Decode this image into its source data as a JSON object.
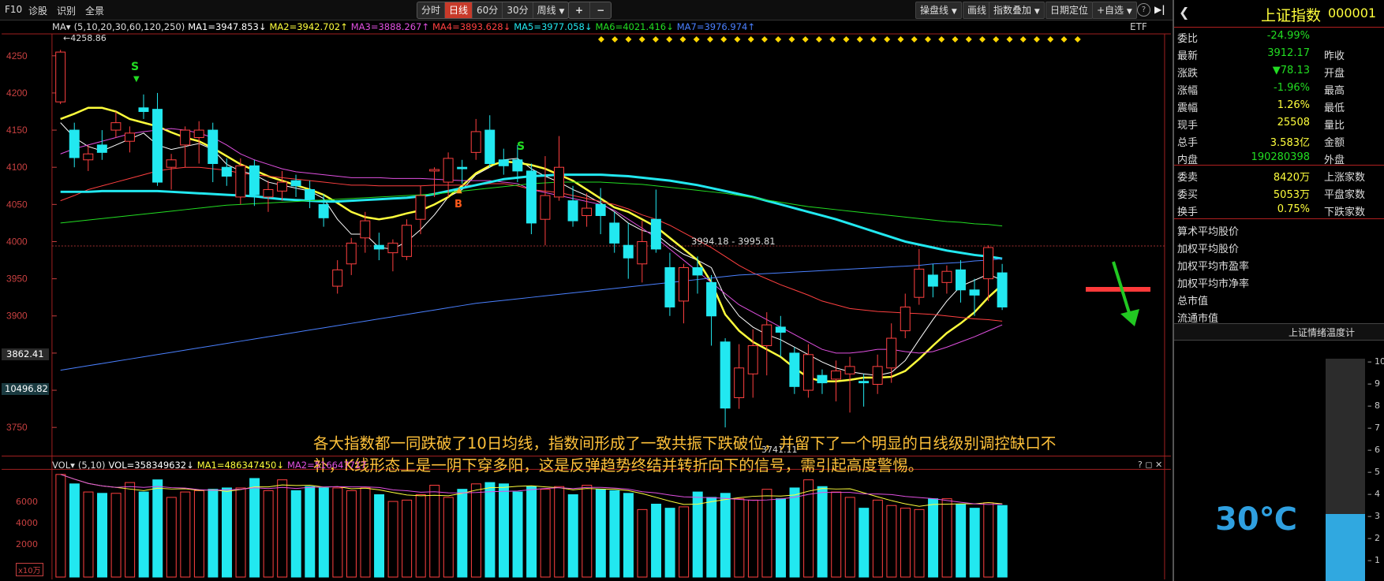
{
  "toolbar": {
    "left": [
      "F10",
      "诊股",
      "识别",
      "全景"
    ],
    "periods": [
      "分时",
      "日线",
      "60分",
      "30分",
      "周线"
    ],
    "active_period": "日线",
    "period_dropdown_icon": "chevron-down-icon",
    "zoom_plus": "+",
    "zoom_minus": "−",
    "right": [
      "操盘线",
      "画线",
      "指数叠加",
      "日期定位",
      "+自选"
    ],
    "help": "?",
    "collapse": "▶|"
  },
  "ma_legend": {
    "label": "MA▾",
    "params": "(5,10,20,30,60,120,250)",
    "items": [
      {
        "text": "MA1=3947.853↓",
        "color": "#ffffff"
      },
      {
        "text": "MA2=3942.702↑",
        "color": "#ffff3c"
      },
      {
        "text": "MA3=3888.267↑",
        "color": "#e050e0"
      },
      {
        "text": "MA4=3893.628↓",
        "color": "#ff4040"
      },
      {
        "text": "MA5=3977.058↓",
        "color": "#22e8f0"
      },
      {
        "text": "MA6=4021.416↓",
        "color": "#22dd22"
      },
      {
        "text": "MA7=3976.974↑",
        "color": "#4a80ff"
      }
    ],
    "etf": "ETF"
  },
  "price_axis": {
    "ticks": [
      "4250",
      "4200",
      "4150",
      "4100",
      "4050",
      "4000",
      "3950",
      "3900",
      "3850",
      "3800",
      "3750"
    ],
    "highlight_price": "3862.41",
    "highlight_vol": "10496.82"
  },
  "annotations": {
    "high_label": "4258.86",
    "low_label": "3741.11",
    "gap_label": "3994.18 - 3995.81",
    "sell_marks": [
      "S",
      "S"
    ],
    "buy_mark": "B"
  },
  "caption": {
    "line1": "各大指数都一同跌破了10日均线，指数间形成了一致共振下跌破位，并留下了一个明显的日线级别调控缺口不",
    "line2": "补，K线形态上是一阴下穿多阳，这是反弹趋势终结并转折向下的信号，需引起高度警惕。"
  },
  "vol_legend": {
    "label": "VOL▾",
    "params": "(5,10)",
    "items": [
      {
        "text": "VOL=358349632↓",
        "color": "#ffffff"
      },
      {
        "text": "MA1=486347450↓",
        "color": "#ffff3c"
      },
      {
        "text": "MA2=516647717",
        "color": "#e050e0"
      }
    ],
    "ticks": [
      "6000",
      "4000",
      "2000"
    ],
    "unit": "x10万",
    "close_icons": "? ◻ ✕"
  },
  "right_panel": {
    "back_icon": "chevron-left-icon",
    "title": "上证指数",
    "code": "000001",
    "rows": [
      {
        "k": "委比",
        "v": "-24.99%",
        "c": "grn",
        "k2": ""
      },
      {
        "k": "最新",
        "v": "3912.17",
        "c": "grn",
        "k2": "昨收"
      },
      {
        "k": "涨跌",
        "v": "▼78.13",
        "c": "grn",
        "k2": "开盘"
      },
      {
        "k": "涨幅",
        "v": "-1.96%",
        "c": "grn",
        "k2": "最高"
      },
      {
        "k": "震幅",
        "v": "1.26%",
        "c": "yel",
        "k2": "最低"
      },
      {
        "k": "现手",
        "v": "25508",
        "c": "yel",
        "k2": "量比"
      },
      {
        "k": "总手",
        "v": "3.583亿",
        "c": "yel",
        "k2": "金额"
      },
      {
        "k": "内盘",
        "v": "190280398",
        "c": "grn",
        "k2": "外盘"
      }
    ],
    "rows2": [
      {
        "k": "委卖",
        "v": "8420万",
        "c": "yel",
        "k2": "上涨家数"
      },
      {
        "k": "委买",
        "v": "5053万",
        "c": "yel",
        "k2": "平盘家数"
      },
      {
        "k": "换手",
        "v": "0.75%",
        "c": "yel",
        "k2": "下跌家数"
      }
    ],
    "list": [
      "算术平均股价",
      "加权平均股价",
      "加权平均市盈率",
      "加权平均市净率",
      "总市值",
      "流通市值"
    ],
    "thermo_title": "上证情绪温度计",
    "thermo_value": "30℃",
    "thermo_level": 0.3,
    "thermo_ticks": [
      "10",
      "9",
      "8",
      "7",
      "6",
      "5",
      "4",
      "3",
      "2",
      "1"
    ]
  },
  "chart_data": {
    "type": "candlestick",
    "ylim": [
      3720,
      4270
    ],
    "candles": [
      [
        4188,
        4255,
        4258,
        4185
      ],
      [
        4150,
        4113,
        4160,
        4100
      ],
      [
        4110,
        4118,
        4130,
        4095
      ],
      [
        4130,
        4120,
        4150,
        4110
      ],
      [
        4150,
        4160,
        4175,
        4140
      ],
      [
        4135,
        4146,
        4155,
        4120
      ],
      [
        4180,
        4175,
        4198,
        4165
      ],
      [
        4178,
        4080,
        4200,
        4075
      ],
      [
        4100,
        4110,
        4118,
        4070
      ],
      [
        4130,
        4150,
        4155,
        4100
      ],
      [
        4140,
        4150,
        4162,
        4105
      ],
      [
        4150,
        4105,
        4160,
        4080
      ],
      [
        4100,
        4088,
        4112,
        4075
      ],
      [
        4060,
        4102,
        4112,
        4050
      ],
      [
        4102,
        4063,
        4110,
        4048
      ],
      [
        4060,
        4070,
        4082,
        4040
      ],
      [
        4068,
        4080,
        4095,
        4055
      ],
      [
        4082,
        4075,
        4090,
        4060
      ],
      [
        4070,
        4057,
        4082,
        4045
      ],
      [
        4050,
        4032,
        4064,
        4020
      ],
      [
        3940,
        3962,
        3975,
        3930
      ],
      [
        3970,
        3998,
        4005,
        3955
      ],
      [
        4005,
        4028,
        4040,
        3985
      ],
      [
        3995,
        3990,
        4012,
        3975
      ],
      [
        3985,
        3998,
        4003,
        3960
      ],
      [
        3980,
        4022,
        4030,
        3975
      ],
      [
        4030,
        4062,
        4075,
        4010
      ],
      [
        4095,
        4097,
        4100,
        4060
      ],
      [
        4080,
        4112,
        4120,
        4060
      ],
      [
        4100,
        4098,
        4110,
        4078
      ],
      [
        4120,
        4148,
        4165,
        4110
      ],
      [
        4150,
        4105,
        4170,
        4100
      ],
      [
        4110,
        4102,
        4125,
        4090
      ],
      [
        4110,
        4095,
        4130,
        4080
      ],
      [
        4095,
        4025,
        4105,
        4010
      ],
      [
        4030,
        4062,
        4115,
        3995
      ],
      [
        4060,
        4100,
        4142,
        4055
      ],
      [
        4055,
        4028,
        4075,
        4020
      ],
      [
        4035,
        4045,
        4065,
        4020
      ],
      [
        4050,
        4035,
        4072,
        4010
      ],
      [
        4025,
        3998,
        4040,
        3985
      ],
      [
        3995,
        3978,
        4025,
        3950
      ],
      [
        3970,
        4000,
        4028,
        3945
      ],
      [
        4030,
        3990,
        4070,
        3985
      ],
      [
        3965,
        3912,
        3985,
        3900
      ],
      [
        3920,
        3965,
        3970,
        3890
      ],
      [
        3965,
        3955,
        3980,
        3930
      ],
      [
        3945,
        3900,
        3955,
        3860
      ],
      [
        3865,
        3776,
        3870,
        3750
      ],
      [
        3790,
        3830,
        3862,
        3775
      ],
      [
        3822,
        3860,
        3882,
        3790
      ],
      [
        3860,
        3888,
        3905,
        3820
      ],
      [
        3885,
        3878,
        3900,
        3845
      ],
      [
        3850,
        3805,
        3858,
        3795
      ],
      [
        3800,
        3848,
        3862,
        3790
      ],
      [
        3820,
        3810,
        3828,
        3795
      ],
      [
        3815,
        3826,
        3840,
        3785
      ],
      [
        3822,
        3832,
        3845,
        3770
      ],
      [
        3812,
        3810,
        3822,
        3778
      ],
      [
        3808,
        3832,
        3848,
        3795
      ],
      [
        3830,
        3870,
        3890,
        3810
      ],
      [
        3880,
        3912,
        3930,
        3870
      ],
      [
        3925,
        3963,
        3990,
        3915
      ],
      [
        3955,
        3940,
        3970,
        3925
      ],
      [
        3945,
        3960,
        3968,
        3930
      ],
      [
        3962,
        3935,
        3975,
        3918
      ],
      [
        3935,
        3928,
        3950,
        3900
      ],
      [
        3950,
        3992,
        3995,
        3920
      ],
      [
        3958,
        3912,
        3970,
        3908
      ]
    ],
    "ma": {
      "MA1": [
        4160,
        4140,
        4128,
        4122,
        4130,
        4138,
        4146,
        4130,
        4124,
        4128,
        4132,
        4124,
        4104,
        4095,
        4090,
        4080,
        4076,
        4072,
        4068,
        4058,
        4030,
        4010,
        4010,
        3992,
        3990,
        4000,
        4016,
        4036,
        4060,
        4070,
        4090,
        4100,
        4110,
        4112,
        4098,
        4088,
        4080,
        4070,
        4062,
        4052,
        4040,
        4025,
        4015,
        4010,
        3995,
        3983,
        3975,
        3965,
        3925,
        3900,
        3885,
        3875,
        3868,
        3858,
        3848,
        3838,
        3830,
        3825,
        3822,
        3820,
        3824,
        3840,
        3868,
        3895,
        3920,
        3940,
        3948,
        3956,
        3948
      ],
      "MA2": [
        4165,
        4172,
        4180,
        4180,
        4175,
        4165,
        4160,
        4155,
        4147,
        4140,
        4135,
        4126,
        4115,
        4104,
        4096,
        4088,
        4082,
        4076,
        4070,
        4063,
        4052,
        4040,
        4033,
        4030,
        4033,
        4038,
        4042,
        4050,
        4060,
        4075,
        4092,
        4102,
        4108,
        4106,
        4103,
        4098,
        4090,
        4082,
        4070,
        4058,
        4046,
        4040,
        4030,
        4020,
        4005,
        3990,
        3975,
        3945,
        3902,
        3880,
        3865,
        3855,
        3845,
        3830,
        3817,
        3812,
        3812,
        3814,
        3817,
        3817,
        3818,
        3826,
        3842,
        3860,
        3877,
        3890,
        3905,
        3925,
        3942
      ],
      "MA3": [
        4118,
        4125,
        4130,
        4135,
        4140,
        4145,
        4148,
        4150,
        4152,
        4150,
        4146,
        4140,
        4130,
        4118,
        4110,
        4104,
        4098,
        4094,
        4092,
        4090,
        4088,
        4086,
        4086,
        4086,
        4085,
        4085,
        4085,
        4084,
        4083,
        4082,
        4082,
        4082,
        4080,
        4078,
        4070,
        4066,
        4062,
        4058,
        4054,
        4050,
        4042,
        4030,
        4018,
        4005,
        3990,
        3975,
        3960,
        3945,
        3930,
        3915,
        3905,
        3895,
        3885,
        3875,
        3865,
        3855,
        3850,
        3850,
        3852,
        3855,
        3855,
        3852,
        3850,
        3852,
        3858,
        3865,
        3872,
        3880,
        3888
      ],
      "MA4": [
        4055,
        4062,
        4070,
        4075,
        4080,
        4085,
        4090,
        4095,
        4098,
        4100,
        4100,
        4098,
        4096,
        4092,
        4090,
        4088,
        4086,
        4084,
        4082,
        4080,
        4078,
        4076,
        4076,
        4075,
        4075,
        4075,
        4075,
        4076,
        4076,
        4076,
        4076,
        4078,
        4078,
        4075,
        4070,
        4068,
        4066,
        4062,
        4058,
        4054,
        4050,
        4044,
        4036,
        4030,
        4022,
        4012,
        4002,
        3992,
        3980,
        3968,
        3958,
        3950,
        3942,
        3935,
        3928,
        3920,
        3915,
        3910,
        3908,
        3906,
        3905,
        3904,
        3903,
        3902,
        3900,
        3898,
        3896,
        3895,
        3893
      ],
      "MA5": [
        4067,
        4067,
        4067,
        4068,
        4068,
        4068,
        4068,
        4068,
        4067,
        4066,
        4065,
        4064,
        4063,
        4062,
        4061,
        4059,
        4057,
        4056,
        4055,
        4054,
        4054,
        4055,
        4056,
        4057,
        4058,
        4059,
        4061,
        4064,
        4068,
        4072,
        4076,
        4080,
        4084,
        4086,
        4088,
        4089,
        4090,
        4090,
        4090,
        4090,
        4089,
        4088,
        4086,
        4084,
        4082,
        4079,
        4076,
        4072,
        4068,
        4064,
        4060,
        4055,
        4050,
        4045,
        4040,
        4035,
        4030,
        4024,
        4018,
        4012,
        4006,
        4000,
        3996,
        3992,
        3988,
        3985,
        3982,
        3980,
        3977
      ],
      "MA6": [
        4025,
        4027,
        4029,
        4031,
        4033,
        4035,
        4037,
        4039,
        4041,
        4043,
        4045,
        4047,
        4049,
        4050,
        4051,
        4052,
        4053,
        4054,
        4055,
        4056,
        4057,
        4058,
        4059,
        4060,
        4061,
        4062,
        4063,
        4064,
        4066,
        4068,
        4070,
        4072,
        4074,
        4076,
        4078,
        4079,
        4080,
        4080,
        4080,
        4080,
        4079,
        4078,
        4077,
        4075,
        4073,
        4071,
        4069,
        4067,
        4065,
        4062,
        4059,
        4056,
        4053,
        4050,
        4047,
        4045,
        4043,
        4041,
        4039,
        4037,
        4035,
        4033,
        4031,
        4029,
        4027,
        4026,
        4024,
        4023,
        4021
      ],
      "MA7": [
        3827,
        3830,
        3833,
        3836,
        3839,
        3842,
        3845,
        3848,
        3851,
        3854,
        3857,
        3860,
        3863,
        3866,
        3869,
        3872,
        3875,
        3878,
        3881,
        3884,
        3887,
        3890,
        3893,
        3896,
        3899,
        3902,
        3905,
        3908,
        3911,
        3914,
        3917,
        3919,
        3921,
        3923,
        3925,
        3927,
        3929,
        3931,
        3933,
        3935,
        3937,
        3939,
        3941,
        3943,
        3945,
        3947,
        3949,
        3951,
        3953,
        3955,
        3956,
        3957,
        3958,
        3959,
        3960,
        3961,
        3962,
        3963,
        3964,
        3965,
        3966,
        3967,
        3968,
        3970,
        3971,
        3972,
        3974,
        3975,
        3977
      ]
    },
    "volume_ylim": [
      0,
      7800
    ],
    "volume": [
      7600,
      6900,
      6300,
      6200,
      6200,
      7000,
      6300,
      7200,
      5900,
      6300,
      6400,
      6500,
      6600,
      6600,
      7300,
      6400,
      7200,
      6400,
      6700,
      6600,
      6600,
      6400,
      6600,
      6100,
      5600,
      5700,
      6100,
      6800,
      5900,
      6500,
      6900,
      7000,
      6900,
      6300,
      6700,
      6500,
      6700,
      6100,
      6800,
      6500,
      6400,
      6200,
      5000,
      5400,
      5100,
      5200,
      6300,
      5900,
      6200,
      5800,
      5700,
      6500,
      5800,
      6600,
      7200,
      6700,
      6300,
      5900,
      5100,
      5700,
      5300,
      5100,
      5000,
      5800,
      5800,
      5400,
      5100,
      5500,
      5300,
      5600,
      5400,
      5300,
      5400,
      5200,
      5100,
      5200,
      5300,
      5700,
      5200,
      5100,
      5000,
      3600
    ]
  }
}
